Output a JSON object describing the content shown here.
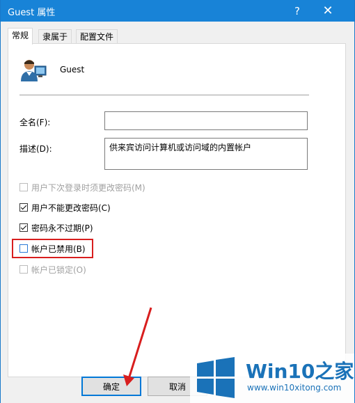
{
  "window": {
    "title": "Guest 属性",
    "help_label": "?",
    "close_label": "✕"
  },
  "tabs": [
    {
      "label": "常规",
      "active": true
    },
    {
      "label": "隶属于",
      "active": false
    },
    {
      "label": "配置文件",
      "active": false
    }
  ],
  "general": {
    "user_name": "Guest",
    "fullname_label": "全名(F):",
    "fullname_value": "",
    "description_label": "描述(D):",
    "description_value": "供来宾访问计算机或访问域的内置帐户",
    "options": [
      {
        "label": "用户下次登录时须更改密码(M)",
        "checked": false,
        "enabled": false
      },
      {
        "label": "用户不能更改密码(C)",
        "checked": true,
        "enabled": true
      },
      {
        "label": "密码永不过期(P)",
        "checked": true,
        "enabled": true
      },
      {
        "label": "帐户已禁用(B)",
        "checked": false,
        "enabled": true,
        "highlighted": true
      },
      {
        "label": "帐户已锁定(O)",
        "checked": false,
        "enabled": false
      }
    ]
  },
  "buttons": {
    "ok": "确定",
    "cancel": "取消"
  },
  "watermark": {
    "brand": "Win10",
    "brand_suffix": "之家",
    "url": "www.win10xitong.com"
  },
  "colors": {
    "titlebar": "#1883d7",
    "highlight": "#d81e1e",
    "watermark": "#1a72b8"
  }
}
